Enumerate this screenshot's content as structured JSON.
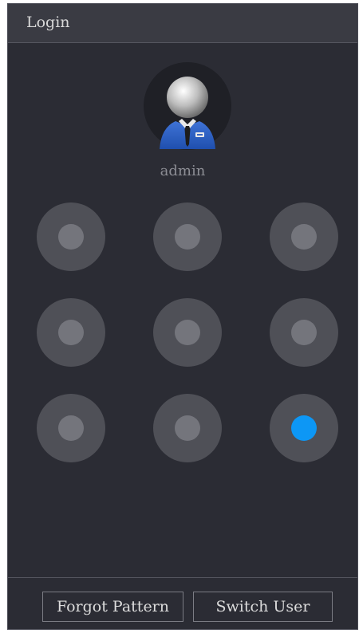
{
  "window": {
    "title": "Login"
  },
  "user": {
    "name": "admin",
    "avatar_icon": "user-avatar-icon"
  },
  "pattern": {
    "rows": 3,
    "cols": 3,
    "selected_index": 8,
    "colors": {
      "node_ring": "#4f5057",
      "node_dot": "#74757c",
      "selected_dot": "#0d97f5"
    }
  },
  "footer": {
    "forgot_label": "Forgot Pattern",
    "switch_label": "Switch User"
  }
}
